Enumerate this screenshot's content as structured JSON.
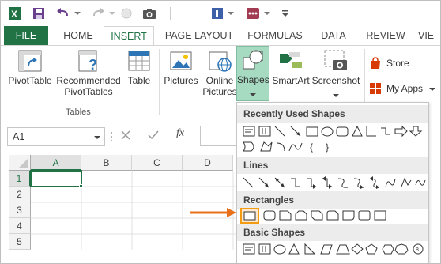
{
  "quick_access": {
    "icons": [
      "excel-logo-icon",
      "save-icon",
      "undo-icon",
      "redo-icon",
      "circle-icon",
      "camera-icon",
      "form-icon",
      "macro-icon",
      "customize-icon"
    ]
  },
  "tabs": [
    "FILE",
    "HOME",
    "INSERT",
    "PAGE LAYOUT",
    "FORMULAS",
    "DATA",
    "REVIEW",
    "VIE"
  ],
  "active_tab": "INSERT",
  "ribbon": {
    "pivottable": "PivotTable",
    "recommended_line1": "Recommended",
    "recommended_line2": "PivotTables",
    "table": "Table",
    "tables_group": "Tables",
    "pictures": "Pictures",
    "online_line1": "Online",
    "online_line2": "Pictures",
    "shapes": "Shapes",
    "smartart": "SmartArt",
    "screenshot": "Screenshot",
    "store": "Store",
    "myapps": "My Apps"
  },
  "formula_bar": {
    "name_box": "A1",
    "fx": "fx"
  },
  "grid": {
    "columns": [
      "A",
      "B",
      "C",
      "D"
    ],
    "rows": [
      "1",
      "2",
      "3",
      "4",
      "5"
    ]
  },
  "shapes_menu": {
    "recent": "Recently Used Shapes",
    "lines": "Lines",
    "rectangles": "Rectangles",
    "basic": "Basic Shapes"
  },
  "colors": {
    "excel_green": "#217346",
    "selection_orange": "#f39c12",
    "arrow_orange": "#e8701a"
  }
}
